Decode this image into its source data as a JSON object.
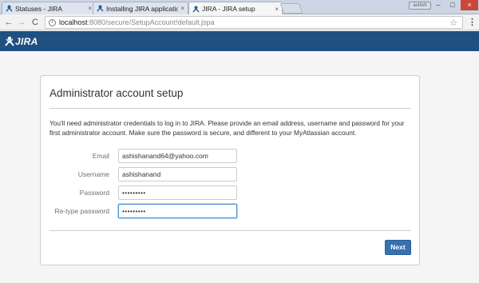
{
  "browser": {
    "tabs": [
      {
        "title": "Statuses - JIRA",
        "active": false
      },
      {
        "title": "Installing JIRA applicatio",
        "active": false
      },
      {
        "title": "JIRA - JIRA setup",
        "active": true
      }
    ],
    "tab_close_glyph": "×",
    "user_badge": "ashish",
    "window_controls": {
      "minimize": "–",
      "maximize": "□",
      "close": "×"
    },
    "nav": {
      "back": "←",
      "forward": "→",
      "reload": "C"
    },
    "url": {
      "host": "localhost",
      "path": ":8080/secure/SetupAccount!default.jspa"
    },
    "icons": [
      "info-icon",
      "star-icon",
      "menu-icon",
      "jira-tab-icon"
    ]
  },
  "header": {
    "logo_text": "JIRA",
    "background_color": "#205081"
  },
  "page": {
    "title": "Administrator account setup",
    "intro": "You'll need administrator credentials to log in to JIRA. Please provide an email address, username and password for your first administrator account. Make sure the password is secure, and different to your MyAtlassian account.",
    "fields": {
      "email": {
        "label": "Email",
        "value": "ashishanand64@yahoo.com"
      },
      "username": {
        "label": "Username",
        "value": "ashishanand"
      },
      "password": {
        "label": "Password",
        "value": "•••••••••"
      },
      "retype_password": {
        "label": "Re-type password",
        "value": "•••••••••"
      }
    },
    "next_label": "Next",
    "accent_color": "#3572b0"
  }
}
